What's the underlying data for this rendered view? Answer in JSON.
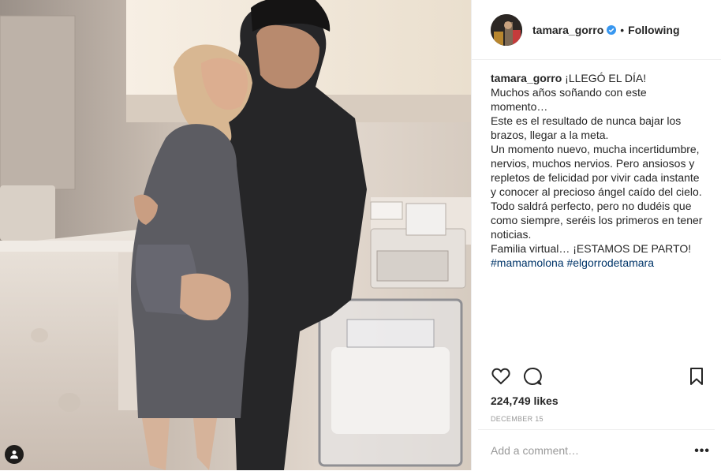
{
  "post": {
    "username": "tamara_gorro",
    "separator": "•",
    "follow_status": "Following",
    "caption_lines": [
      "¡LLEGÓ EL DÍA!",
      "Muchos años soñando con este momento…",
      "Este es el resultado de nunca bajar los brazos, llegar a la meta.",
      "Un momento nuevo, mucha incertidumbre, nervios, muchos nervios. Pero ansiosos y repletos de felicidad por vivir cada instante y conocer al precioso ángel caído del cielo.",
      "Todo saldrá perfecto, pero no dudéis que como siempre, seréis los primeros en tener noticias.",
      "Familia virtual… ¡ESTAMOS DE PARTO!"
    ],
    "hashtags": "#mamamolona #elgorrodetamara",
    "likes": "224,749 likes",
    "date": "DECEMBER 15",
    "comment_placeholder": "Add a comment…",
    "more_label": "•••"
  },
  "icons": {
    "like": "heart-icon",
    "comment": "comment-icon",
    "save": "bookmark-icon",
    "tag": "user-tag-icon",
    "verified": "verified-badge-icon"
  },
  "colors": {
    "text": "#262626",
    "muted": "#999999",
    "hashtag": "#003569",
    "verified": "#3897f0",
    "border": "#efefef"
  }
}
